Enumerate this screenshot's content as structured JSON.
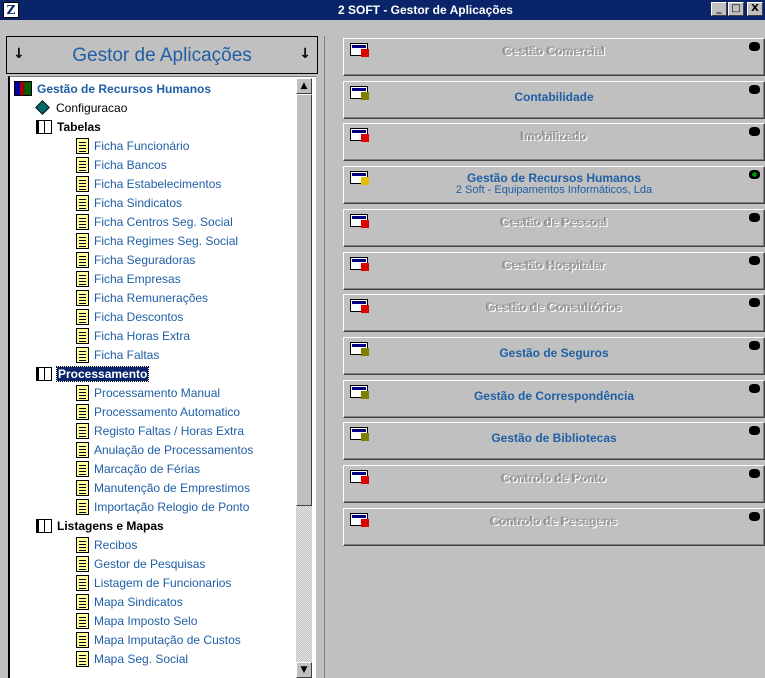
{
  "window": {
    "title": "2 SOFT - Gestor de Aplicações",
    "app_icon_glyph": "Z",
    "minimize": "_",
    "maximize": "□",
    "close": "X"
  },
  "left": {
    "header_title": "Gestor de Aplicações",
    "arrow_left": "↓",
    "arrow_right": "↓",
    "scroll_up": "▲",
    "scroll_down": "▼"
  },
  "tree": [
    {
      "label": "Gestão de Recursos Humanos",
      "level": 0,
      "icon": "books-icon"
    },
    {
      "label": "Configuracao",
      "level": 1,
      "icon": "gem-icon",
      "plain": true
    },
    {
      "label": "Tabelas",
      "level": 1,
      "icon": "book-icon"
    },
    {
      "label": "Ficha Funcionário",
      "level": 2,
      "icon": "document-icon"
    },
    {
      "label": "Ficha Bancos",
      "level": 2,
      "icon": "document-icon"
    },
    {
      "label": "Ficha Estabelecimentos",
      "level": 2,
      "icon": "document-icon"
    },
    {
      "label": "Ficha Sindicatos",
      "level": 2,
      "icon": "document-icon"
    },
    {
      "label": "Ficha Centros Seg. Social",
      "level": 2,
      "icon": "document-icon"
    },
    {
      "label": "Ficha Regimes Seg. Social",
      "level": 2,
      "icon": "document-icon"
    },
    {
      "label": "Ficha Seguradoras",
      "level": 2,
      "icon": "document-icon"
    },
    {
      "label": "Ficha Empresas",
      "level": 2,
      "icon": "document-icon"
    },
    {
      "label": "Ficha Remunerações",
      "level": 2,
      "icon": "document-icon"
    },
    {
      "label": "Ficha Descontos",
      "level": 2,
      "icon": "document-icon"
    },
    {
      "label": "Ficha Horas Extra",
      "level": 2,
      "icon": "document-icon"
    },
    {
      "label": "Ficha Faltas",
      "level": 2,
      "icon": "document-icon"
    },
    {
      "label": "Processamento",
      "level": 1,
      "icon": "book-icon",
      "selected": true
    },
    {
      "label": "Processamento Manual",
      "level": 2,
      "icon": "document-icon"
    },
    {
      "label": "Processamento Automatico",
      "level": 2,
      "icon": "document-icon"
    },
    {
      "label": "Registo  Faltas / Horas Extra",
      "level": 2,
      "icon": "document-icon"
    },
    {
      "label": "Anulação de Processamentos",
      "level": 2,
      "icon": "document-icon"
    },
    {
      "label": "Marcação de Férias",
      "level": 2,
      "icon": "document-icon"
    },
    {
      "label": "Manutenção de Emprestimos",
      "level": 2,
      "icon": "document-icon"
    },
    {
      "label": "Importação Relogio de Ponto",
      "level": 2,
      "icon": "document-icon"
    },
    {
      "label": "Listagens e Mapas",
      "level": 1,
      "icon": "book-icon"
    },
    {
      "label": "Recibos",
      "level": 2,
      "icon": "document-icon"
    },
    {
      "label": "Gestor de Pesquisas",
      "level": 2,
      "icon": "document-icon"
    },
    {
      "label": "Listagem de Funcionarios",
      "level": 2,
      "icon": "document-icon"
    },
    {
      "label": "Mapa Sindicatos",
      "level": 2,
      "icon": "document-icon"
    },
    {
      "label": "Mapa Imposto Selo",
      "level": 2,
      "icon": "document-icon"
    },
    {
      "label": "Mapa Imputação de Custos",
      "level": 2,
      "icon": "document-icon"
    },
    {
      "label": "Mapa Seg. Social",
      "level": 2,
      "icon": "document-icon"
    }
  ],
  "apps": [
    {
      "name": "Gestão Comercial",
      "state": "off"
    },
    {
      "name": "Contabilidade",
      "state": "on"
    },
    {
      "name": "Imobilizado",
      "state": "off"
    },
    {
      "name": "Gestão de Recursos Humanos",
      "state": "active",
      "subtitle": "2 Soft - Equipamentos Informáticos, Lda"
    },
    {
      "name": "Gestão de Pessoal",
      "state": "off"
    },
    {
      "name": "Gestão Hospitalar",
      "state": "off"
    },
    {
      "name": "Gestão de Consultórios",
      "state": "off"
    },
    {
      "name": "Gestão de Seguros",
      "state": "on"
    },
    {
      "name": "Gestão de Correspondência",
      "state": "on"
    },
    {
      "name": "Gestão de Bibliotecas",
      "state": "on"
    },
    {
      "name": "Controlo de Ponto",
      "state": "off"
    },
    {
      "name": "Controlo de Pesagens",
      "state": "off"
    }
  ],
  "colors": {
    "titlebar": "#0a246a",
    "link_blue": "#1f5fa6",
    "face": "#c0c0c0",
    "disabled_marker": "#e00000",
    "enabled_marker": "#808000"
  }
}
